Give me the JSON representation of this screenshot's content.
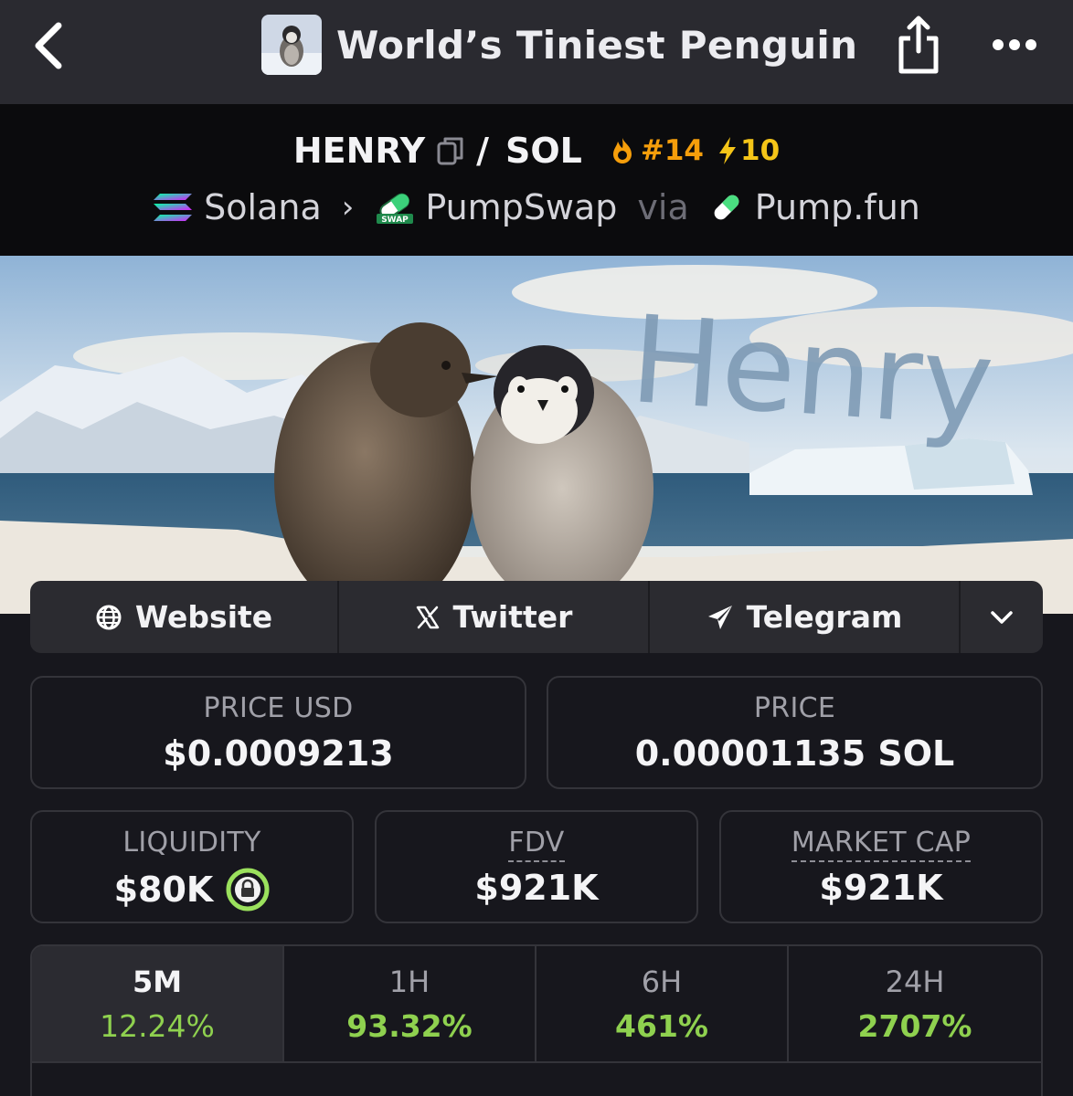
{
  "header": {
    "title": "World’s Tiniest Penguin",
    "back_icon": "chevron-left-icon",
    "share_icon": "share-icon",
    "more_icon": "more-dots-icon"
  },
  "pair": {
    "base": "HENRY",
    "slash": "/",
    "quote": "SOL",
    "rank": "#14",
    "boosts": "10",
    "chain": "Solana",
    "dex": "PumpSwap",
    "via": "via",
    "launchpad": "Pump.fun"
  },
  "banner": {
    "text": "Henry"
  },
  "links": {
    "website": "Website",
    "twitter": "Twitter",
    "telegram": "Telegram"
  },
  "stats": {
    "price_usd_label": "PRICE USD",
    "price_usd": "$0.0009213",
    "price_label": "PRICE",
    "price": "0.00001135 SOL",
    "liquidity_label": "LIQUIDITY",
    "liquidity": "$80K",
    "fdv_label": "FDV",
    "fdv": "$921K",
    "mcap_label": "MARKET CAP",
    "mcap": "$921K"
  },
  "timeframes": [
    {
      "label": "5M",
      "change": "12.24%"
    },
    {
      "label": "1H",
      "change": "93.32%"
    },
    {
      "label": "6H",
      "change": "461%"
    },
    {
      "label": "24H",
      "change": "2707%"
    }
  ],
  "colors": {
    "positive": "#8fd14f",
    "rank": "#f59e0b",
    "boost": "#f5c518",
    "lock": "#9be15d"
  }
}
